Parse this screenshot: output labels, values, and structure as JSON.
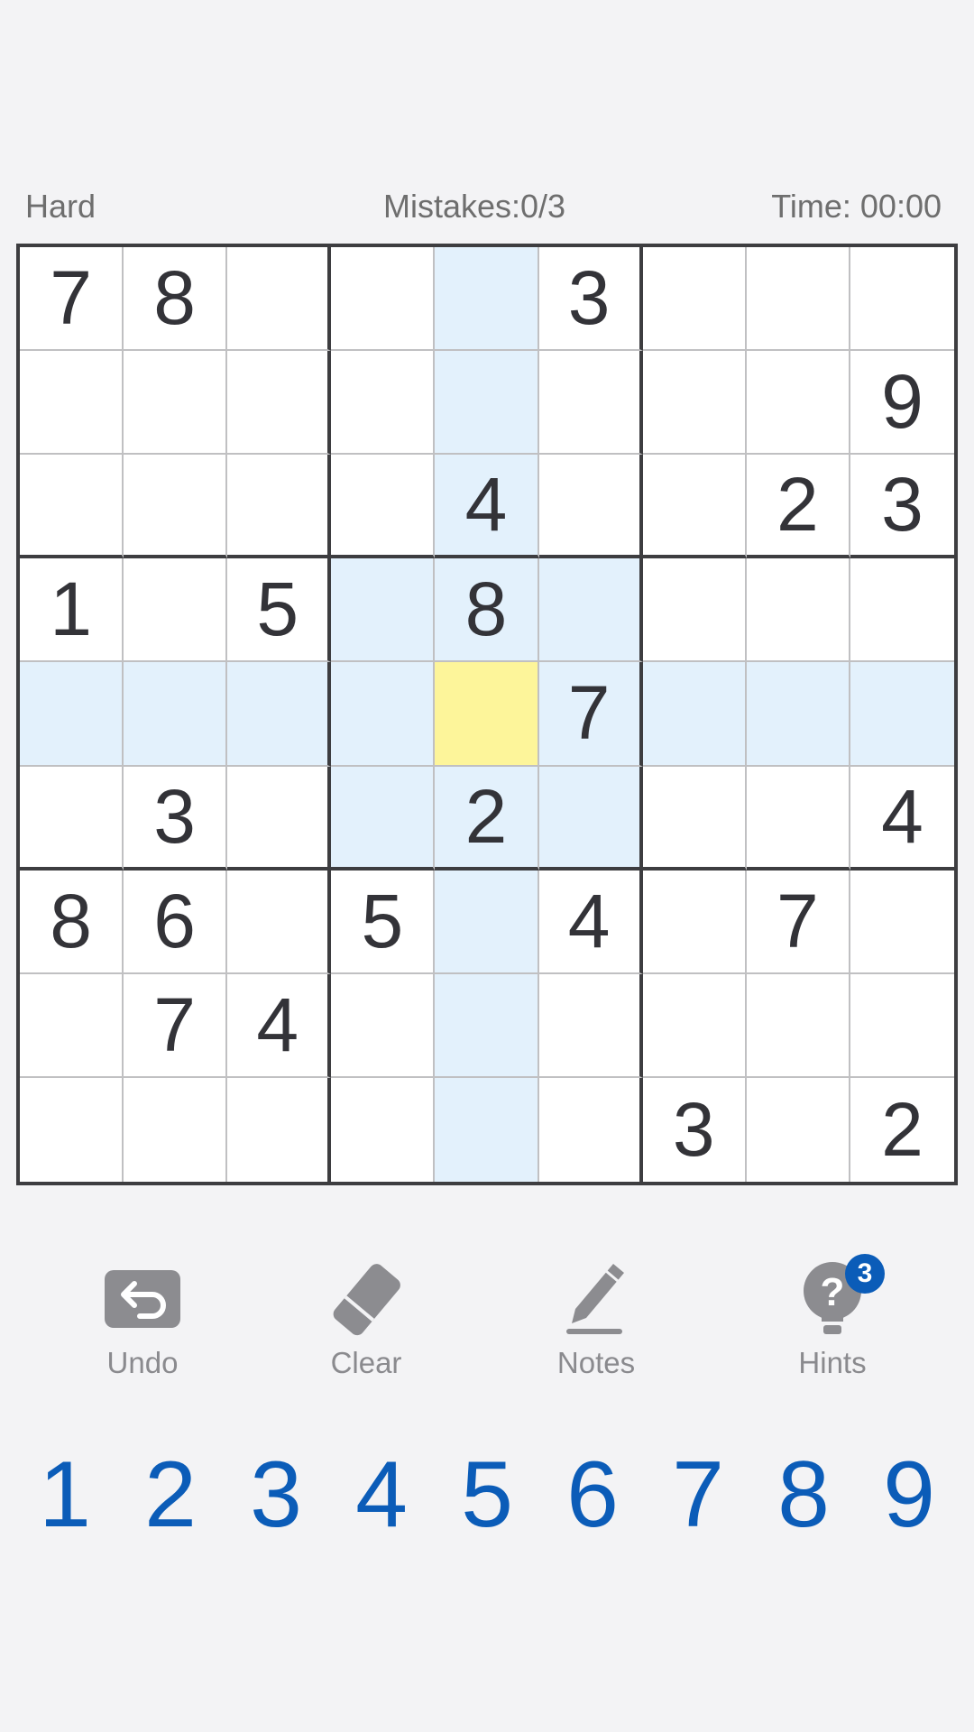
{
  "status": {
    "difficulty": "Hard",
    "mistakes": "Mistakes:0/3",
    "time": "Time: 00:00"
  },
  "board": {
    "selected": [
      4,
      4
    ],
    "grid": [
      [
        "7",
        "8",
        "",
        "",
        "",
        "3",
        "",
        "",
        ""
      ],
      [
        "",
        "",
        "",
        "",
        "",
        "",
        "",
        "",
        "9"
      ],
      [
        "",
        "",
        "",
        "",
        "4",
        "",
        "",
        "2",
        "3"
      ],
      [
        "1",
        "",
        "5",
        "",
        "8",
        "",
        "",
        "",
        ""
      ],
      [
        "",
        "",
        "",
        "",
        "",
        "7",
        "",
        "",
        ""
      ],
      [
        "",
        "3",
        "",
        "",
        "2",
        "",
        "",
        "",
        "4"
      ],
      [
        "8",
        "6",
        "",
        "5",
        "",
        "4",
        "",
        "7",
        ""
      ],
      [
        "",
        "7",
        "4",
        "",
        "",
        "",
        "",
        "",
        ""
      ],
      [
        "",
        "",
        "",
        "",
        "",
        "",
        "3",
        "",
        "2"
      ]
    ]
  },
  "tools": {
    "undo": {
      "label": "Undo",
      "icon": "undo-icon"
    },
    "clear": {
      "label": "Clear",
      "icon": "eraser-icon"
    },
    "notes": {
      "label": "Notes",
      "icon": "pencil-icon"
    },
    "hints": {
      "label": "Hints",
      "icon": "lightbulb-question-icon",
      "badge": "3"
    }
  },
  "numpad": [
    "1",
    "2",
    "3",
    "4",
    "5",
    "6",
    "7",
    "8",
    "9"
  ],
  "colors": {
    "accent": "#0b5cb8",
    "highlight": "#e3f1fc",
    "selected": "#fdf59a"
  }
}
